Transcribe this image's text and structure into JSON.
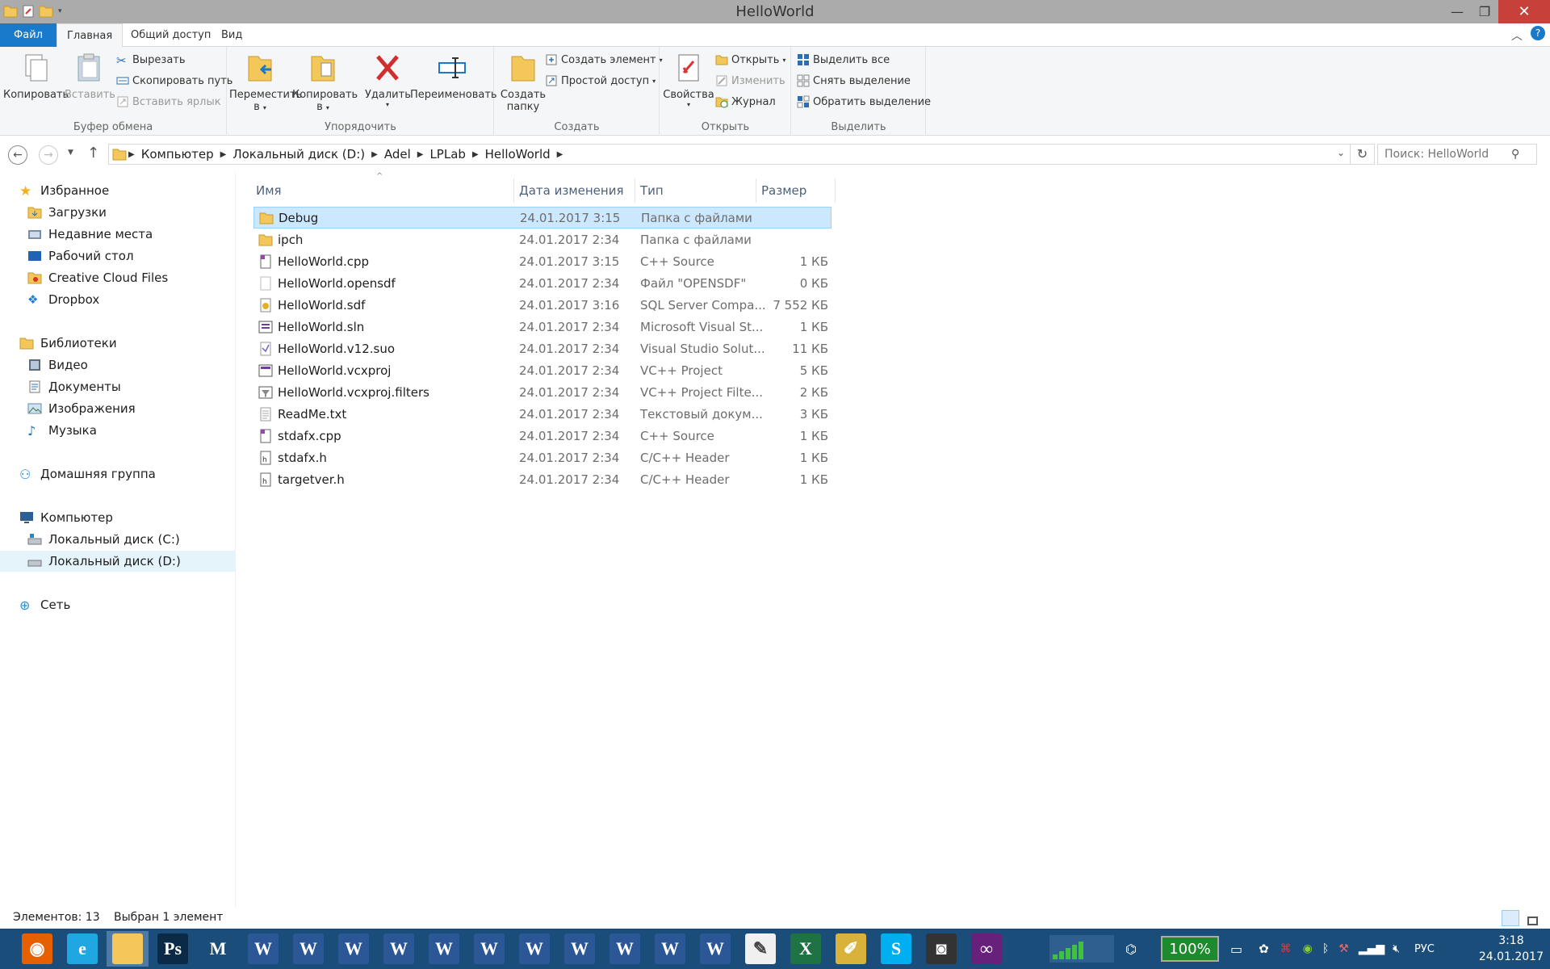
{
  "window": {
    "title": "HelloWorld"
  },
  "ribbon_tabs": [
    "Файл",
    "Главная",
    "Общий доступ",
    "Вид"
  ],
  "ribbon": {
    "clipboard": {
      "label": "Буфер обмена",
      "copy": "Копировать",
      "paste": "Вставить",
      "cut": "Вырезать",
      "copy_path": "Скопировать путь",
      "paste_shortcut": "Вставить ярлык"
    },
    "organize": {
      "label": "Упорядочить",
      "move_to": "Переместить",
      "copy_to": "Копировать",
      "to": "в",
      "delete": "Удалить",
      "rename": "Переименовать"
    },
    "create": {
      "label": "Создать",
      "new_folder_1": "Создать",
      "new_folder_2": "папку",
      "new_item": "Создать элемент",
      "easy_access": "Простой доступ"
    },
    "open": {
      "label": "Открыть",
      "properties": "Свойства",
      "open": "Открыть",
      "edit": "Изменить",
      "history": "Журнал"
    },
    "select": {
      "label": "Выделить",
      "select_all": "Выделить все",
      "select_none": "Снять выделение",
      "invert": "Обратить выделение"
    }
  },
  "address": {
    "breadcrumbs": [
      "Компьютер",
      "Локальный диск (D:)",
      "Adel",
      "LPLab",
      "HelloWorld"
    ]
  },
  "search": {
    "placeholder": "Поиск: HelloWorld"
  },
  "nav_pane": {
    "favorites": "Избранное",
    "favorites_items": [
      "Загрузки",
      "Недавние места",
      "Рабочий стол",
      "Creative Cloud Files",
      "Dropbox"
    ],
    "libraries": "Библиотеки",
    "libraries_items": [
      "Видео",
      "Документы",
      "Изображения",
      "Музыка"
    ],
    "homegroup": "Домашняя группа",
    "computer": "Компьютер",
    "computer_items": [
      "Локальный диск (C:)",
      "Локальный диск (D:)"
    ],
    "network": "Сеть"
  },
  "columns": {
    "name": "Имя",
    "date": "Дата изменения",
    "type": "Тип",
    "size": "Размер"
  },
  "files": [
    {
      "name": "Debug",
      "date": "24.01.2017 3:15",
      "type": "Папка с файлами",
      "size": "",
      "icon": "folder-icon",
      "selected": true
    },
    {
      "name": "ipch",
      "date": "24.01.2017 2:34",
      "type": "Папка с файлами",
      "size": "",
      "icon": "folder-icon"
    },
    {
      "name": "HelloWorld.cpp",
      "date": "24.01.2017 3:15",
      "type": "C++ Source",
      "size": "1 КБ",
      "icon": "cpp-file-icon"
    },
    {
      "name": "HelloWorld.opensdf",
      "date": "24.01.2017 2:34",
      "type": "Файл \"OPENSDF\"",
      "size": "0 КБ",
      "icon": "blank-file-icon"
    },
    {
      "name": "HelloWorld.sdf",
      "date": "24.01.2017 3:16",
      "type": "SQL Server Compa...",
      "size": "7 552 КБ",
      "icon": "sdf-file-icon"
    },
    {
      "name": "HelloWorld.sln",
      "date": "24.01.2017 2:34",
      "type": "Microsoft Visual St...",
      "size": "1 КБ",
      "icon": "sln-file-icon"
    },
    {
      "name": "HelloWorld.v12.suo",
      "date": "24.01.2017 2:34",
      "type": "Visual Studio Solut...",
      "size": "11 КБ",
      "icon": "suo-file-icon"
    },
    {
      "name": "HelloWorld.vcxproj",
      "date": "24.01.2017 2:34",
      "type": "VC++ Project",
      "size": "5 КБ",
      "icon": "vcxproj-file-icon"
    },
    {
      "name": "HelloWorld.vcxproj.filters",
      "date": "24.01.2017 2:34",
      "type": "VC++ Project Filte...",
      "size": "2 КБ",
      "icon": "filters-file-icon"
    },
    {
      "name": "ReadMe.txt",
      "date": "24.01.2017 2:34",
      "type": "Текстовый докум...",
      "size": "3 КБ",
      "icon": "text-file-icon"
    },
    {
      "name": "stdafx.cpp",
      "date": "24.01.2017 2:34",
      "type": "C++ Source",
      "size": "1 КБ",
      "icon": "cpp-file-icon"
    },
    {
      "name": "stdafx.h",
      "date": "24.01.2017 2:34",
      "type": "C/C++ Header",
      "size": "1 КБ",
      "icon": "header-file-icon"
    },
    {
      "name": "targetver.h",
      "date": "24.01.2017 2:34",
      "type": "C/C++ Header",
      "size": "1 КБ",
      "icon": "header-file-icon"
    }
  ],
  "status": {
    "count": "Элементов: 13",
    "selection": "Выбран 1 элемент"
  },
  "taskbar": {
    "apps": [
      "firefox-icon",
      "internet-explorer-icon",
      "file-explorer-icon",
      "photoshop-icon",
      "mathcad-icon",
      "word-icon",
      "word-icon",
      "word-icon",
      "word-icon",
      "word-icon",
      "word-icon",
      "word-icon",
      "word-icon",
      "word-icon",
      "word-icon",
      "word-icon",
      "paint-icon",
      "excel-icon",
      "paint-brush-icon",
      "skype-icon",
      "camera-icon",
      "visual-studio-icon"
    ],
    "battery": "100%",
    "language": "РУС",
    "time": "3:18",
    "date": "24.01.2017"
  },
  "colors": {
    "accent": "#1979ca",
    "selection": "#cce8ff",
    "taskbar": "#1b4d7b",
    "close": "#c7413a",
    "word": "#2b5797",
    "excel": "#1f7244",
    "folder": "#f3c75a"
  }
}
